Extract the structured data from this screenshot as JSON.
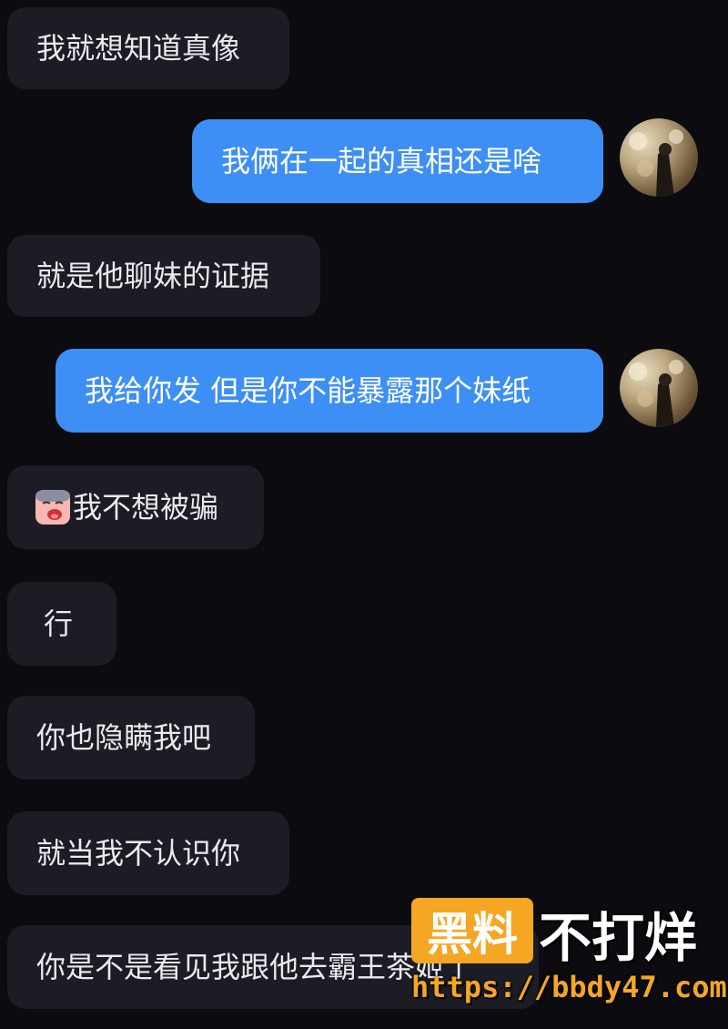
{
  "messages": [
    {
      "side": "in",
      "text": "我就想知道真像"
    },
    {
      "side": "out",
      "text": "我俩在一起的真相还是啥"
    },
    {
      "side": "in",
      "text": "就是他聊妹的证据"
    },
    {
      "side": "out",
      "text": "我给你发 但是你不能暴露那个妹纸"
    },
    {
      "side": "in",
      "text": "我不想被骗",
      "icon": "crying-face-icon"
    },
    {
      "side": "in",
      "text": "行"
    },
    {
      "side": "in",
      "text": "你也隐瞒我吧"
    },
    {
      "side": "in",
      "text": "就当我不认识你"
    },
    {
      "side": "in",
      "text": "你是不是看见我跟他去霸王茶姬了"
    }
  ],
  "watermark": {
    "brand": "黑料",
    "slogan": "不打烊",
    "url": "https://bbdy47.com",
    "accent": "#f5a623"
  },
  "colors": {
    "background": "#0b0b10",
    "incoming_bubble": "#1c1c24",
    "outgoing_bubble": "#3d8ff5"
  }
}
